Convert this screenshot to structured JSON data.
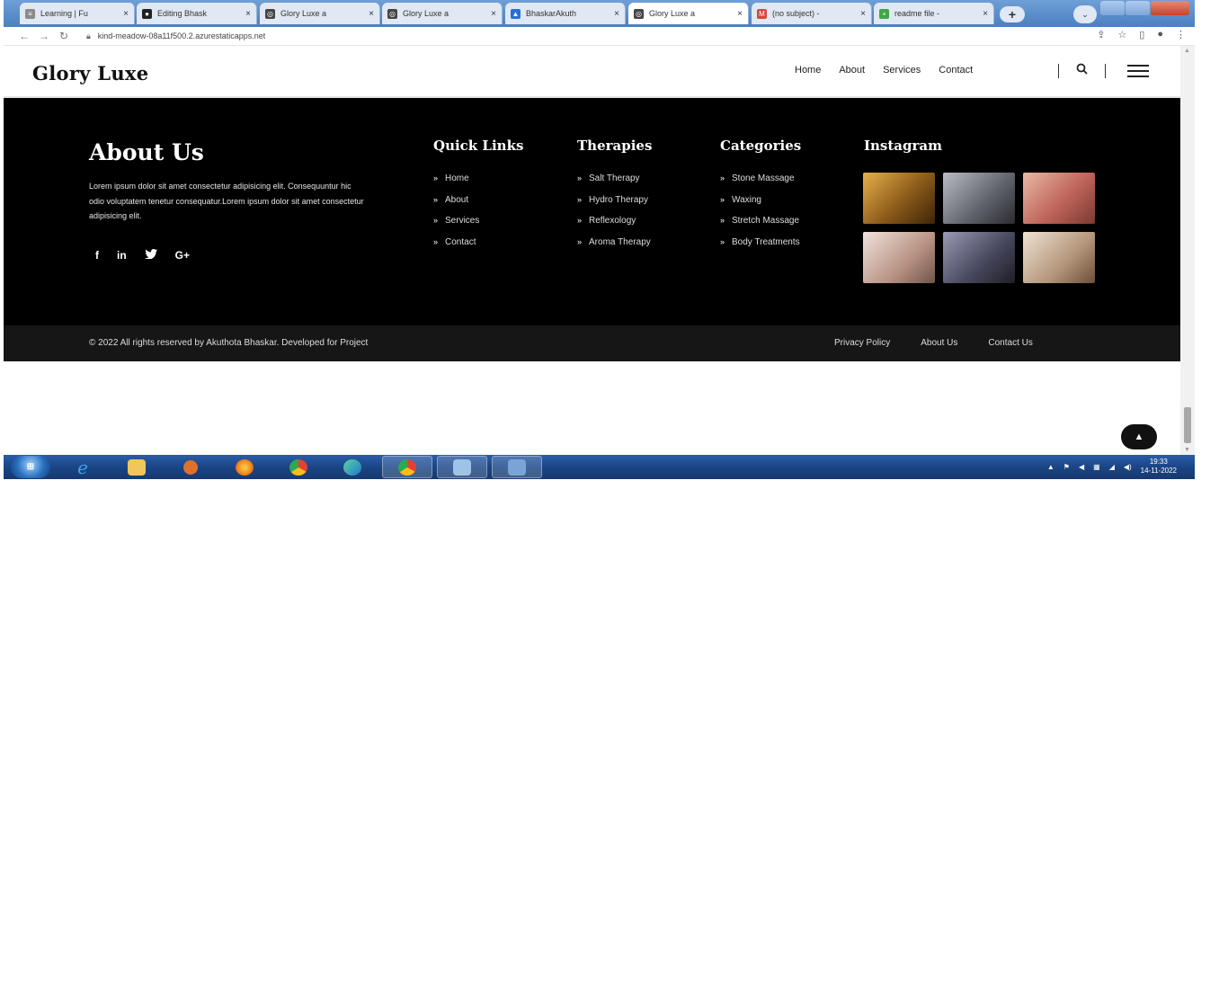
{
  "browser": {
    "tabs": [
      {
        "label": "Learning | Fu",
        "icon": "doc-icon",
        "color": "#8a8a8a"
      },
      {
        "label": "Editing Bhask",
        "icon": "github-icon",
        "color": "#222222"
      },
      {
        "label": "Glory Luxe a",
        "icon": "globe-icon",
        "color": "#444444"
      },
      {
        "label": "Glory Luxe a",
        "icon": "globe-icon",
        "color": "#444444"
      },
      {
        "label": "BhaskarAkuth",
        "icon": "azure-icon",
        "color": "#2a6fd6"
      },
      {
        "label": "Glory Luxe a",
        "icon": "globe-icon",
        "color": "#444444"
      },
      {
        "label": "(no subject) -",
        "icon": "gmail-icon",
        "color": "#d9453a"
      },
      {
        "label": "readme file -",
        "icon": "file-icon",
        "color": "#3fa845"
      }
    ],
    "url": "kind-meadow-08a11f500.2.azurestaticapps.net"
  },
  "site": {
    "brand": "Glory Luxe",
    "nav": [
      "Home",
      "About",
      "Services",
      "Contact"
    ]
  },
  "footer": {
    "about_title": "About Us",
    "about_text": "Lorem ipsum dolor sit amet consectetur adipisicing elit. Consequuntur hic odio voluptatem tenetur consequatur.Lorem ipsum dolor sit amet consectetur adipisicing elit.",
    "socials": [
      "f",
      "in",
      "tw",
      "G+"
    ],
    "quick_links": {
      "title": "Quick Links",
      "items": [
        "Home",
        "About",
        "Services",
        "Contact"
      ]
    },
    "therapies": {
      "title": "Therapies",
      "items": [
        "Salt Therapy",
        "Hydro Therapy",
        "Reflexology",
        "Aroma Therapy"
      ]
    },
    "categories": {
      "title": "Categories",
      "items": [
        "Stone Massage",
        "Waxing",
        "Stretch Massage",
        "Body Treatments"
      ]
    },
    "instagram": {
      "title": "Instagram",
      "images": [
        {
          "name": "candles-spa-photo",
          "colors": [
            "#c98b2c",
            "#5a3a14"
          ]
        },
        {
          "name": "woman-makeup-photo",
          "colors": [
            "#8a8d96",
            "#3b3b40"
          ]
        },
        {
          "name": "flower-massage-photo",
          "colors": [
            "#d9a08a",
            "#b5584a"
          ]
        },
        {
          "name": "facial-mask-photo",
          "colors": [
            "#e0ccc4",
            "#8b6f64"
          ]
        },
        {
          "name": "flowers-treatment-photo",
          "colors": [
            "#6d6d8a",
            "#2b2b35"
          ]
        },
        {
          "name": "relaxing-woman-photo",
          "colors": [
            "#d9c7b3",
            "#7b5c43"
          ]
        }
      ]
    },
    "copyright": "© 2022 All rights reserved by Akuthota Bhaskar. Developed for Project",
    "legal_links": [
      "Privacy Policy",
      "About Us",
      "Contact Us"
    ]
  },
  "taskbar": {
    "apps": [
      {
        "name": "ie-icon",
        "color": "#3fa3e6"
      },
      {
        "name": "explorer-icon",
        "color": "#f1c75c"
      },
      {
        "name": "media-player-icon",
        "color": "#e0702a"
      },
      {
        "name": "firefox-icon",
        "color": "#f0821e"
      },
      {
        "name": "chrome-icon",
        "color": "#e9a91d"
      },
      {
        "name": "edge-icon",
        "color": "#2fa3c8"
      },
      {
        "name": "chrome-active-icon",
        "color": "#e9a91d"
      },
      {
        "name": "files-icon",
        "color": "#9ec3e8"
      },
      {
        "name": "paint-icon",
        "color": "#7aa4d8"
      }
    ],
    "time": "19:33",
    "date": "14-11-2022"
  }
}
